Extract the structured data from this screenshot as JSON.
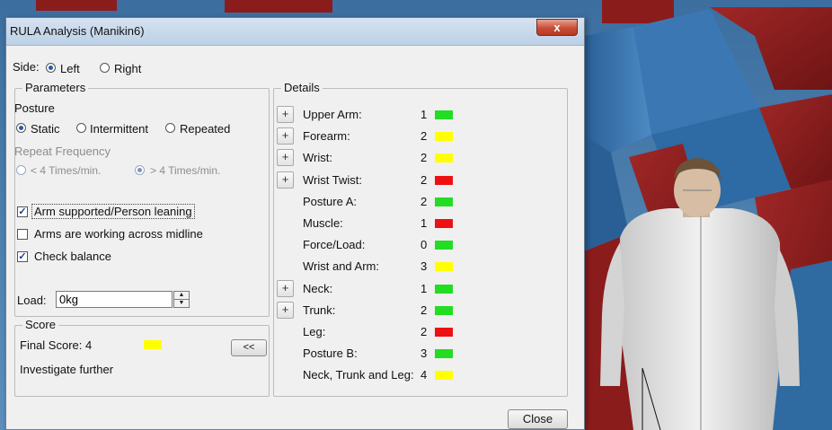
{
  "window": {
    "title": "RULA Analysis (Manikin6)",
    "close_glyph": "x"
  },
  "side": {
    "label": "Side:",
    "options": [
      {
        "label": "Left",
        "selected": true
      },
      {
        "label": "Right",
        "selected": false
      }
    ]
  },
  "parameters": {
    "legend": "Parameters",
    "posture_label": "Posture",
    "posture_options": [
      {
        "label": "Static",
        "selected": true
      },
      {
        "label": "Intermittent",
        "selected": false
      },
      {
        "label": "Repeated",
        "selected": false
      }
    ],
    "repeat_label": "Repeat Frequency",
    "repeat_options": [
      {
        "label": "< 4 Times/min.",
        "selected": false
      },
      {
        "label": "> 4 Times/min.",
        "selected": true
      }
    ],
    "checks": [
      {
        "label": "Arm supported/Person leaning",
        "checked": true
      },
      {
        "label": "Arms are working across midline",
        "checked": false
      },
      {
        "label": "Check balance",
        "checked": true
      }
    ],
    "load_label": "Load:",
    "load_value": "0kg"
  },
  "score": {
    "legend": "Score",
    "final_label": "Final Score: 4",
    "final_color": "#ffff00",
    "status": "Investigate further",
    "collapse_label": "<<"
  },
  "details": {
    "legend": "Details",
    "expand_glyph": "+",
    "rows": [
      {
        "label": "Upper Arm:",
        "value": "1",
        "color": "#22dd22",
        "expandable": true
      },
      {
        "label": "Forearm:",
        "value": "2",
        "color": "#ffff00",
        "expandable": true
      },
      {
        "label": "Wrist:",
        "value": "2",
        "color": "#ffff00",
        "expandable": true
      },
      {
        "label": "Wrist Twist:",
        "value": "2",
        "color": "#ee1111",
        "expandable": true
      },
      {
        "label": "Posture A:",
        "value": "2",
        "color": "#22dd22",
        "expandable": false
      },
      {
        "label": "Muscle:",
        "value": "1",
        "color": "#ee1111",
        "expandable": false
      },
      {
        "label": "Force/Load:",
        "value": "0",
        "color": "#22dd22",
        "expandable": false
      },
      {
        "label": "Wrist and Arm:",
        "value": "3",
        "color": "#ffff00",
        "expandable": false
      },
      {
        "label": "Neck:",
        "value": "1",
        "color": "#22dd22",
        "expandable": true
      },
      {
        "label": "Trunk:",
        "value": "2",
        "color": "#22dd22",
        "expandable": true
      },
      {
        "label": "Leg:",
        "value": "2",
        "color": "#ee1111",
        "expandable": false
      },
      {
        "label": "Posture B:",
        "value": "3",
        "color": "#22dd22",
        "expandable": false
      },
      {
        "label": "Neck, Trunk and Leg:",
        "value": "4",
        "color": "#ffff00",
        "expandable": false
      }
    ]
  },
  "footer": {
    "close_label": "Close"
  },
  "scene": {
    "seat_color": "#8f1f1f",
    "seat_frame_color": "#2f6fa8",
    "floor_color": "#4a7fae"
  }
}
